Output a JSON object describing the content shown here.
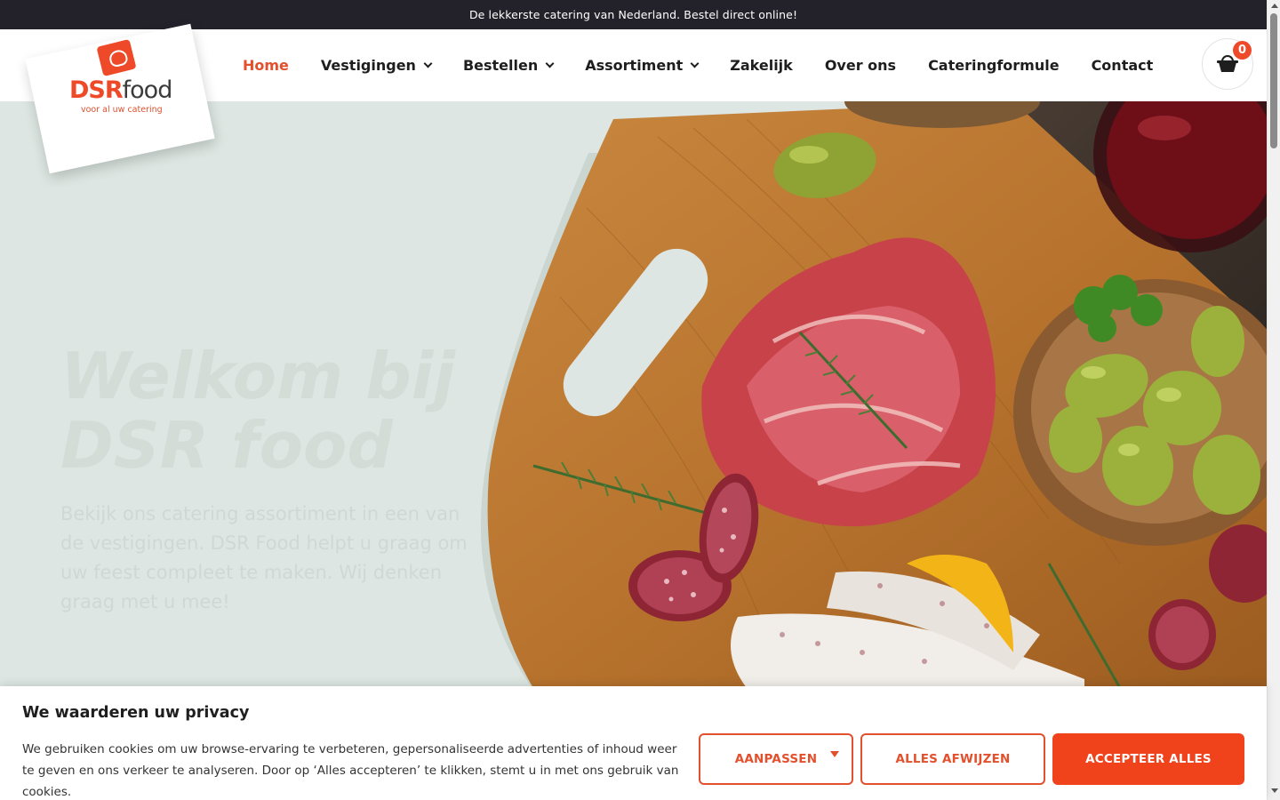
{
  "topbar": {
    "text": "De lekkerste catering van Nederland. Bestel direct online!"
  },
  "logo": {
    "brand_main": "DSR",
    "brand_sub": "food",
    "tagline": "voor al uw catering"
  },
  "nav": {
    "items": [
      {
        "label": "Home",
        "active": true,
        "dropdown": false
      },
      {
        "label": "Vestigingen",
        "active": false,
        "dropdown": true
      },
      {
        "label": "Bestellen",
        "active": false,
        "dropdown": true
      },
      {
        "label": "Assortiment",
        "active": false,
        "dropdown": true
      },
      {
        "label": "Zakelijk",
        "active": false,
        "dropdown": false
      },
      {
        "label": "Over ons",
        "active": false,
        "dropdown": false
      },
      {
        "label": "Cateringformule",
        "active": false,
        "dropdown": false
      },
      {
        "label": "Contact",
        "active": false,
        "dropdown": false
      }
    ]
  },
  "cart": {
    "icon": "basket-icon",
    "count": "0"
  },
  "hero": {
    "title_line1": "Welkom bij",
    "title_line2": "DSR food",
    "text": "Bekijk ons catering assortiment in een van de vestigingen. DSR Food helpt u graag om uw feest compleet te maken. Wij denken graag met u mee!",
    "background": "#dde6e2"
  },
  "cookie": {
    "title": "We waarderen uw privacy",
    "text": "We gebruiken cookies om uw browse-ervaring te verbeteren, gepersonaliseerde advertenties of inhoud weer te geven en ons verkeer te analyseren. Door op ‘Alles accepteren’ te klikken, stemt u in met ons gebruik van cookies.",
    "customize_label": "AANPASSEN",
    "reject_label": "ALLES AFWIJZEN",
    "accept_label": "ACCEPTEER ALLES"
  },
  "colors": {
    "accent": "#e2502d",
    "topbar": "#23222b",
    "button_fill": "#f0431c"
  }
}
